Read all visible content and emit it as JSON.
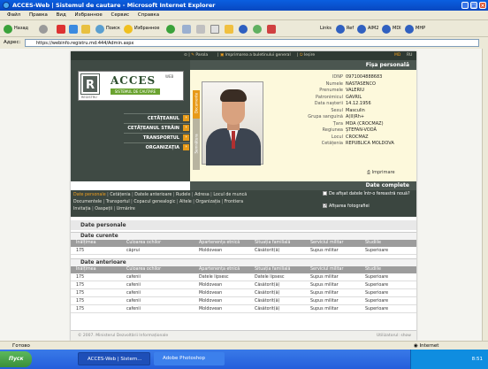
{
  "window": {
    "title": "ACCES-Web | Sistemul de cautare - Microsoft Internet Explorer"
  },
  "menu": [
    "Файл",
    "Правка",
    "Вид",
    "Избранное",
    "Сервис",
    "Справка"
  ],
  "toolbar": {
    "back": "Назад",
    "search": "Поиск",
    "favorites": "Избранное",
    "links": [
      "Links",
      "Ref",
      "AIM2",
      "MDI",
      "MHP"
    ]
  },
  "address": {
    "label": "Адрес:",
    "url": "https://webinfo.registru.md:444/Admin.aspx"
  },
  "topstrip": {
    "parola": "Parola",
    "imprimare": "Imprimarea a buletinului general",
    "iesire": "Ieșire",
    "lang1": "MD",
    "lang2": "RU"
  },
  "logo": {
    "name": "ACCES",
    "web": "WEB",
    "subtitle": "SISTEMUL DE CAUTARE",
    "registru": "REGISTRU"
  },
  "nav": [
    {
      "label": "CETĂȚEANUL"
    },
    {
      "label": "CETĂȚEANUL STRĂIN"
    },
    {
      "label": "TRANSPORTUL"
    },
    {
      "label": "ORGANIZAȚIA"
    }
  ],
  "card": {
    "title": "Fișa personală",
    "vtabs": [
      "Documente",
      "Semnătura"
    ],
    "fields": [
      {
        "label": "IDNP",
        "value": "0971004888683"
      },
      {
        "label": "Numele",
        "value": "NASTASENCO"
      },
      {
        "label": "Prenumele",
        "value": "VALERIU"
      },
      {
        "label": "Patronimicul",
        "value": "GAVRIL"
      },
      {
        "label": "Data nașterii",
        "value": "14.12.1956"
      },
      {
        "label": "Sexul",
        "value": "Masculin"
      },
      {
        "label": "Grupa sanguină",
        "value": "A(II)Rh+"
      },
      {
        "label": "Țara",
        "value": "MDA (CROCMAZ)"
      },
      {
        "label": "Regiunea",
        "value": "ȘTEFAN-VODĂ"
      },
      {
        "label": "Locul",
        "value": "CROCMAZ"
      },
      {
        "label": "Cetățenia",
        "value": "REPUBLICA MOLDOVA"
      }
    ],
    "print": "Imprimare",
    "complete": "Date complete"
  },
  "links": {
    "row1": [
      "Date personale",
      "Cetățenia",
      "Datele anterioare",
      "Rudele",
      "Adresa",
      "Locul de muncă"
    ],
    "row2": [
      "Documentele",
      "Transportul",
      "Copacul genealogic",
      "Altele",
      "Organizația",
      "Frontiera"
    ],
    "row3": [
      "Invitația",
      "Oaspeții",
      "Urmărire"
    ]
  },
  "options": {
    "newwindow": "De afișat datele într-o fereastră nouă?",
    "photos": "Afișarea fotografiei"
  },
  "section": {
    "title": "Date personale",
    "current": "Date curente",
    "previous": "Date anterioare"
  },
  "columns": [
    "Înălțimea",
    "Culoarea ochilor",
    "Apartenența etnică",
    "Situația familială",
    "Serviciul militar",
    "Studiile"
  ],
  "current_rows": [
    [
      "175",
      "căprui",
      "Moldovean",
      "Căsătorit(ă)",
      "Supus militar",
      "Superioare"
    ]
  ],
  "previous_rows": [
    [
      "175",
      "cafenii",
      "Datele lipsesc",
      "Datele lipsesc",
      "Supus militar",
      "Superioare"
    ],
    [
      "175",
      "cafenii",
      "Moldovean",
      "Căsătorit(ă)",
      "Supus militar",
      "Superioare"
    ],
    [
      "175",
      "cafenii",
      "Moldovean",
      "Căsătorit(ă)",
      "Supus militar",
      "Superioare"
    ],
    [
      "175",
      "cafenii",
      "Moldovean",
      "Căsătorit(ă)",
      "Supus militar",
      "Superioare"
    ],
    [
      "175",
      "cafenii",
      "Moldovean",
      "Căsătorit(ă)",
      "Supus militar",
      "Superioare"
    ]
  ],
  "footer": {
    "left": "© 2007. Ministerul Dezvoltării Informaționale",
    "right": "Utilizatorul: show"
  },
  "status": {
    "left": "Готово",
    "zone": "Internet"
  },
  "taskbar": {
    "start": "Пуск",
    "tasks": [
      "ACCES-Web | Sistem...",
      "Adobe Photoshop"
    ],
    "clock": "8:51"
  }
}
